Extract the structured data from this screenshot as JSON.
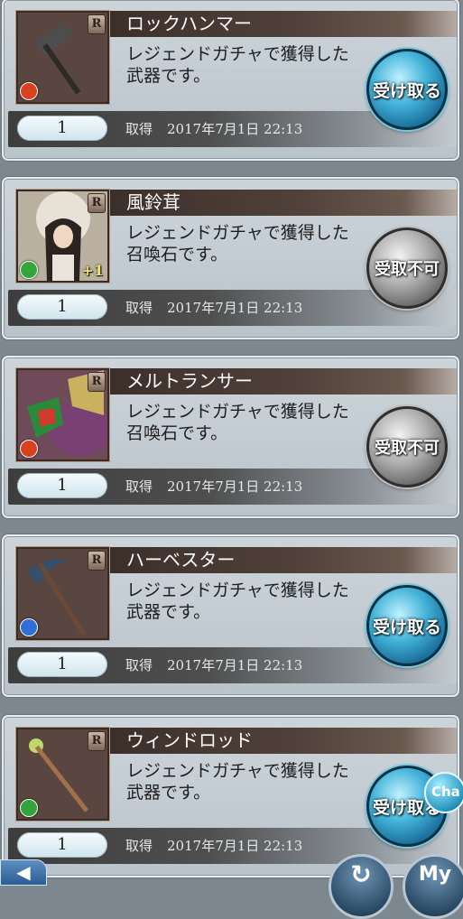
{
  "cards": [
    {
      "name": "ロックハンマー",
      "rarity": "R",
      "desc": "レジェンドガチャで獲得した武器です。",
      "qty": "1",
      "obtained_label": "取得",
      "date": "2017年7月1日 22:13",
      "button": "受け取る",
      "button_state": "receive",
      "element": "fire",
      "plus": ""
    },
    {
      "name": "風鈴茸",
      "rarity": "R",
      "desc": "レジェンドガチャで獲得した召喚石です。",
      "qty": "1",
      "obtained_label": "取得",
      "date": "2017年7月1日 22:13",
      "button": "受取不可",
      "button_state": "disabled",
      "element": "wind",
      "plus": "+1"
    },
    {
      "name": "メルトランサー",
      "rarity": "R",
      "desc": "レジェンドガチャで獲得した召喚石です。",
      "qty": "1",
      "obtained_label": "取得",
      "date": "2017年7月1日 22:13",
      "button": "受取不可",
      "button_state": "disabled",
      "element": "fire",
      "plus": ""
    },
    {
      "name": "ハーベスター",
      "rarity": "R",
      "desc": "レジェンドガチャで獲得した武器です。",
      "qty": "1",
      "obtained_label": "取得",
      "date": "2017年7月1日 22:13",
      "button": "受け取る",
      "button_state": "receive",
      "element": "water",
      "plus": ""
    },
    {
      "name": "ウィンドロッド",
      "rarity": "R",
      "desc": "レジェンドガチャで獲得した武器です。",
      "qty": "1",
      "obtained_label": "取得",
      "date": "2017年7月1日 22:13",
      "button": "受け取る",
      "button_state": "receive",
      "element": "wind",
      "plus": ""
    }
  ],
  "bottom_nav": {
    "back_glyph": "◀",
    "reload_glyph": "↻",
    "my_label": "My"
  },
  "chat": {
    "label": "Cha"
  },
  "colors": {
    "fire": "#d9421e",
    "wind": "#33a53a",
    "water": "#2f6fd6"
  }
}
